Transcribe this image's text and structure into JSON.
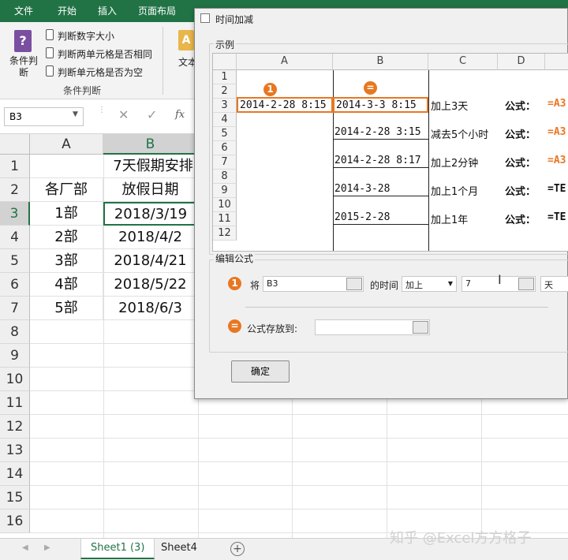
{
  "ribbon": {
    "tabs": [
      "文件",
      "开始",
      "插入",
      "页面布局"
    ],
    "big_button": "条件判断",
    "items": [
      "判断数字大小",
      "判断两单元格是否相同",
      "判断单元格是否为空"
    ],
    "group_label": "条件判断",
    "text_button": "文本"
  },
  "formula_bar": {
    "name_box": "B3",
    "fx": "fx"
  },
  "sheet": {
    "col_a": "A",
    "col_b": "B",
    "rows": [
      "1",
      "2",
      "3",
      "4",
      "5",
      "6",
      "7",
      "8",
      "9",
      "10",
      "11",
      "12",
      "13",
      "14",
      "15",
      "16"
    ],
    "title": "7天假期安排",
    "header_a": "各厂部",
    "header_b": "放假日期",
    "a_values": [
      "1部",
      "2部",
      "3部",
      "4部",
      "5部"
    ],
    "b_values": [
      "2018/3/19",
      "2018/4/2",
      "2018/4/21",
      "2018/5/22",
      "2018/6/3"
    ]
  },
  "sheet_tabs": [
    "Sheet1 (3)",
    "Sheet4"
  ],
  "dialog": {
    "title": "时间加减",
    "example_label": "示例",
    "example_cols": [
      "A",
      "B",
      "C",
      "D"
    ],
    "example_rows": [
      "1",
      "2",
      "3",
      "4",
      "5",
      "6",
      "7",
      "8",
      "9",
      "10",
      "11",
      "12"
    ],
    "badge_1": "1",
    "badge_eq": "=",
    "a3": "2014-2-28 8:15",
    "b3": "2014-3-3 8:15",
    "b5": "2014-2-28 3:15",
    "b7": "2014-2-28 8:17",
    "b9": "2014-3-28",
    "b11": "2015-2-28",
    "c3": "加上3天",
    "c5": "减去5个小时",
    "c7": "加上2分钟",
    "c9": "加上1个月",
    "c11": "加上1年",
    "formula_label": "公式：",
    "e3": "=A3",
    "e5": "=A3",
    "e7": "=A3",
    "e9": "=TE",
    "e11": "=TE",
    "edit_label": "编辑公式",
    "jiang": "将",
    "source_value": "B3",
    "de_shijian": "的时间",
    "op_value": "加上",
    "amount_value": "7",
    "unit_value": "天",
    "store_label": "公式存放到:",
    "ok_label": "确定"
  },
  "watermark": "知乎 @Excel方方格子"
}
